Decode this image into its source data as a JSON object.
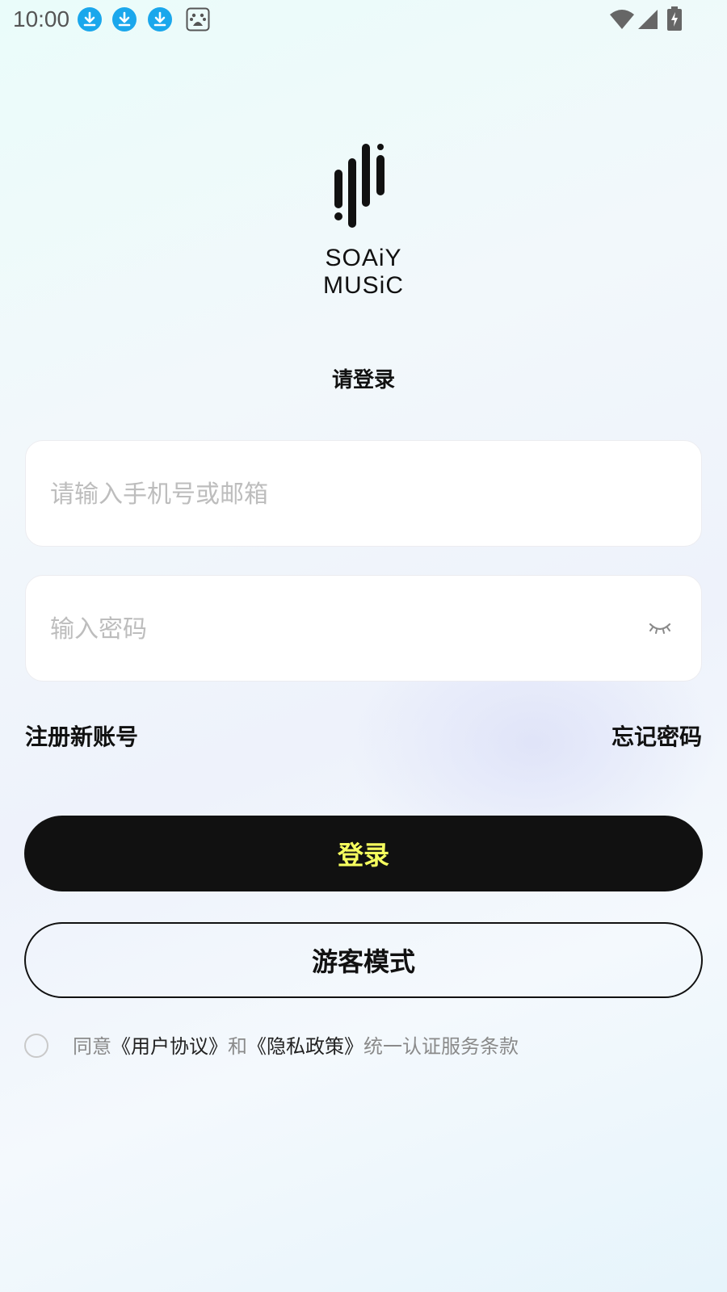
{
  "status_bar": {
    "time": "10:00",
    "icons": [
      "download-icon",
      "download-icon",
      "download-icon",
      "baidu-icon",
      "wifi-icon",
      "signal-icon",
      "battery-charging-icon"
    ]
  },
  "brand": {
    "name": "SOAiY MUSiC",
    "logo_icon": "sound-bars-icon"
  },
  "login": {
    "subtitle": "请登录",
    "account_placeholder": "请输入手机号或邮箱",
    "account_value": "",
    "password_placeholder": "输入密码",
    "password_value": "",
    "password_toggle_icon": "eye-closed-icon",
    "register_link": "注册新账号",
    "forgot_link": "忘记密码",
    "login_button": "登录",
    "guest_button": "游客模式"
  },
  "agreement": {
    "checked": false,
    "prefix": "同意",
    "user_agreement": "《用户协议》",
    "and": "和",
    "privacy_policy": "《隐私政策》",
    "suffix": "统一认证服务条款"
  },
  "colors": {
    "primary_button_bg": "#111111",
    "primary_button_text": "#f6ff5e",
    "placeholder": "#bdbdbd",
    "muted_text": "#8a8a8a"
  }
}
